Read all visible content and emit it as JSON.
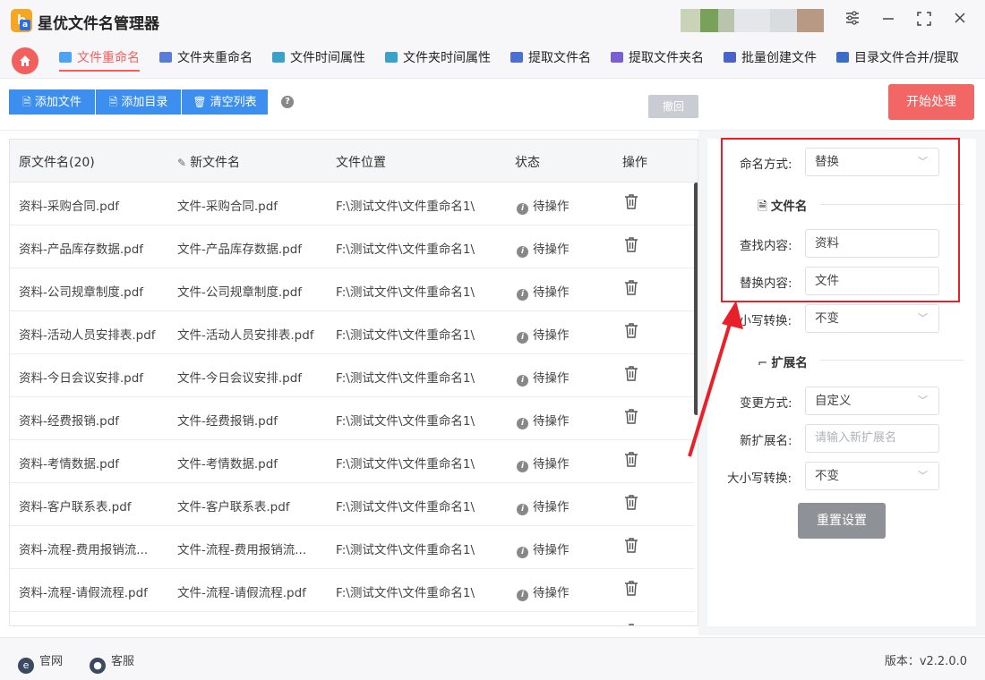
{
  "app": {
    "title": "星优文件名管理器",
    "logo_letters": "ba"
  },
  "window_controls": {
    "settings": "⚙",
    "minimize": "—",
    "maximize": "⛶",
    "close": "✕"
  },
  "nav": {
    "tabs": [
      {
        "label": "文件重命名",
        "icon": "file-rename-icon",
        "color": "#4ea1f3"
      },
      {
        "label": "文件夹重命名",
        "icon": "folder-rename-icon",
        "color": "#5a7bd6"
      },
      {
        "label": "文件时间属性",
        "icon": "file-time-icon",
        "color": "#3da0c9"
      },
      {
        "label": "文件夹时间属性",
        "icon": "folder-time-icon",
        "color": "#3da0c9"
      },
      {
        "label": "提取文件名",
        "icon": "extract-filename-icon",
        "color": "#4c6fd1"
      },
      {
        "label": "提取文件夹名",
        "icon": "extract-foldername-icon",
        "color": "#7a5fd0"
      },
      {
        "label": "批量创建文件",
        "icon": "batch-create-icon",
        "color": "#4b63c9"
      },
      {
        "label": "目录文件合并/提取",
        "icon": "merge-extract-icon",
        "color": "#3b6cc6"
      }
    ],
    "active_index": 0
  },
  "toolbar": {
    "add_file": "添加文件",
    "add_dir": "添加目录",
    "clear_list": "清空列表",
    "help": "?",
    "undo": "撤回",
    "start": "开始处理"
  },
  "table": {
    "headers": {
      "original": "原文件名(20)",
      "new": "新文件名",
      "location": "文件位置",
      "status": "状态",
      "action": "操作"
    },
    "rows": [
      {
        "original": "资料-采购合同.pdf",
        "new": "文件-采购合同.pdf",
        "location": "F:\\测试文件\\文件重命名1\\",
        "status": "待操作"
      },
      {
        "original": "资料-产品库存数据.pdf",
        "new": "文件-产品库存数据.pdf",
        "location": "F:\\测试文件\\文件重命名1\\",
        "status": "待操作"
      },
      {
        "original": "资料-公司规章制度.pdf",
        "new": "文件-公司规章制度.pdf",
        "location": "F:\\测试文件\\文件重命名1\\",
        "status": "待操作"
      },
      {
        "original": "资料-活动人员安排表.pdf",
        "new": "文件-活动人员安排表.pdf",
        "location": "F:\\测试文件\\文件重命名1\\",
        "status": "待操作"
      },
      {
        "original": "资料-今日会议安排.pdf",
        "new": "文件-今日会议安排.pdf",
        "location": "F:\\测试文件\\文件重命名1\\",
        "status": "待操作"
      },
      {
        "original": "资料-经费报销.pdf",
        "new": "文件-经费报销.pdf",
        "location": "F:\\测试文件\\文件重命名1\\",
        "status": "待操作"
      },
      {
        "original": "资料-考情数据.pdf",
        "new": "文件-考情数据.pdf",
        "location": "F:\\测试文件\\文件重命名1\\",
        "status": "待操作"
      },
      {
        "original": "资料-客户联系表.pdf",
        "new": "文件-客户联系表.pdf",
        "location": "F:\\测试文件\\文件重命名1\\",
        "status": "待操作"
      },
      {
        "original": "资料-流程-费用报销流...",
        "new": "文件-流程-费用报销流...",
        "location": "F:\\测试文件\\文件重命名1\\",
        "status": "待操作"
      },
      {
        "original": "资料-流程-请假流程.pdf",
        "new": "文件-流程-请假流程.pdf",
        "location": "F:\\测试文件\\文件重命名1\\",
        "status": "待操作"
      }
    ]
  },
  "settings": {
    "naming_mode_label": "命名方式:",
    "naming_mode_value": "替换",
    "filename_section": "文件名",
    "find_label": "查找内容:",
    "find_value": "资料",
    "replace_label": "替换内容:",
    "replace_value": "文件",
    "case_label": "大小写转换:",
    "case_value": "不变",
    "ext_section": "扩展名",
    "change_mode_label": "变更方式:",
    "change_mode_value": "自定义",
    "new_ext_label": "新扩展名:",
    "new_ext_placeholder": "请输入新扩展名",
    "ext_case_label": "大小写转换:",
    "ext_case_value": "不变",
    "reset": "重置设置"
  },
  "footer": {
    "website": "官网",
    "support": "客服",
    "version": "版本：v2.2.0.0"
  },
  "colors": {
    "accent": "#f25f5c",
    "primary_button": "#3d8fef",
    "highlight": "#e8202a"
  }
}
